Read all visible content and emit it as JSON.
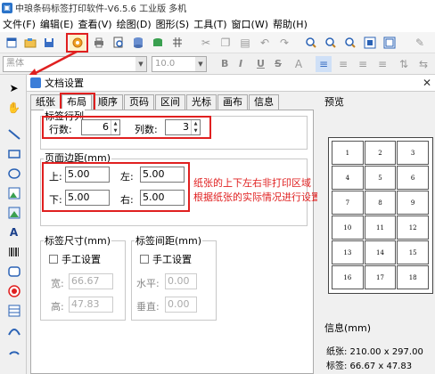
{
  "app": {
    "title": "中琅条码标签打印软件-V6.5.6 工业版 多机"
  },
  "menu": [
    "文件(F)",
    "编辑(E)",
    "查看(V)",
    "绘图(D)",
    "图形(S)",
    "工具(T)",
    "窗口(W)",
    "帮助(H)"
  ],
  "toolbar2": {
    "font_placeholder": "黑体",
    "font_size": "10.0",
    "bold": "B",
    "italic": "I",
    "underline": "U",
    "strike": "S"
  },
  "dialog": {
    "title": "文档设置",
    "close": "✕",
    "tabs": [
      "纸张",
      "布局",
      "顺序",
      "页码",
      "区间",
      "光标",
      "画布",
      "信息"
    ],
    "active_tab": "布局",
    "layout": {
      "rows_cols_title": "标签行列",
      "rows_label": "行数:",
      "rows_value": "6",
      "cols_label": "列数:",
      "cols_value": "3",
      "margins_title": "页面边距(mm)",
      "top_label": "上:",
      "top_value": "5.00",
      "left_label": "左:",
      "left_value": "5.00",
      "bottom_label": "下:",
      "bottom_value": "5.00",
      "right_label": "右:",
      "right_value": "5.00",
      "note_line1": "纸张的上下左右非打印区域",
      "note_line2": "根据纸张的实际情况进行设置",
      "size_title": "标签尺寸(mm)",
      "size_manual": "手工设置",
      "width_label": "宽:",
      "width_value": "66.67",
      "height_label": "高:",
      "height_value": "47.83",
      "spacing_title": "标签间距(mm)",
      "spacing_manual": "手工设置",
      "h_label": "水平:",
      "h_value": "0.00",
      "v_label": "垂直:",
      "v_value": "0.00"
    },
    "preview": {
      "title": "预览",
      "cells": [
        "1",
        "2",
        "3",
        "4",
        "5",
        "6",
        "7",
        "8",
        "9",
        "10",
        "11",
        "12",
        "13",
        "14",
        "15",
        "16",
        "17",
        "18"
      ],
      "info_title": "信息(mm)",
      "paper_info": "纸张: 210.00 x 297.00",
      "label_info": "标签: 66.67 x 47.83"
    }
  }
}
